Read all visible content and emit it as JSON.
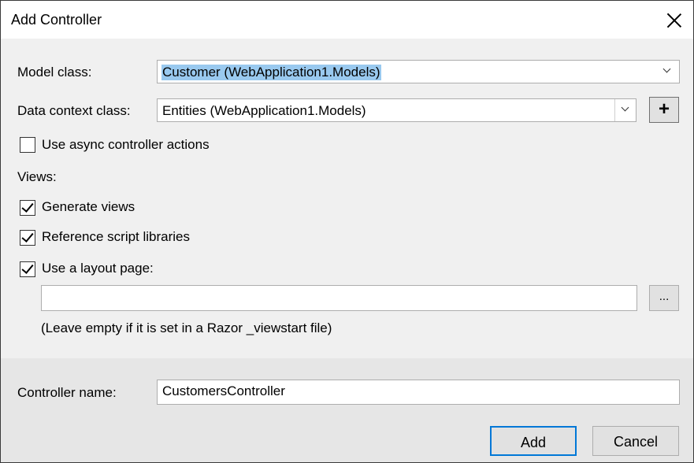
{
  "window": {
    "title": "Add Controller"
  },
  "model_class": {
    "label": "Model class:",
    "value": "Customer (WebApplication1.Models)"
  },
  "data_context": {
    "label": "Data context class:",
    "value": "Entities (WebApplication1.Models)",
    "add_symbol": "+"
  },
  "options": {
    "async_label": "Use async controller actions",
    "async_checked": false
  },
  "views": {
    "heading": "Views:",
    "generate_label": "Generate views",
    "generate_checked": true,
    "scripts_label": "Reference script libraries",
    "scripts_checked": true,
    "layout_label": "Use a layout page:",
    "layout_checked": true,
    "layout_path_value": "",
    "browse_label": "...",
    "hint": "(Leave empty if it is set in a Razor _viewstart file)"
  },
  "controller": {
    "label": "Controller name:",
    "value": "CustomersController"
  },
  "buttons": {
    "add": "Add",
    "cancel": "Cancel"
  },
  "colors": {
    "accent": "#0078d7",
    "selection": "#99c9ef",
    "panel": "#f0f0f0"
  }
}
